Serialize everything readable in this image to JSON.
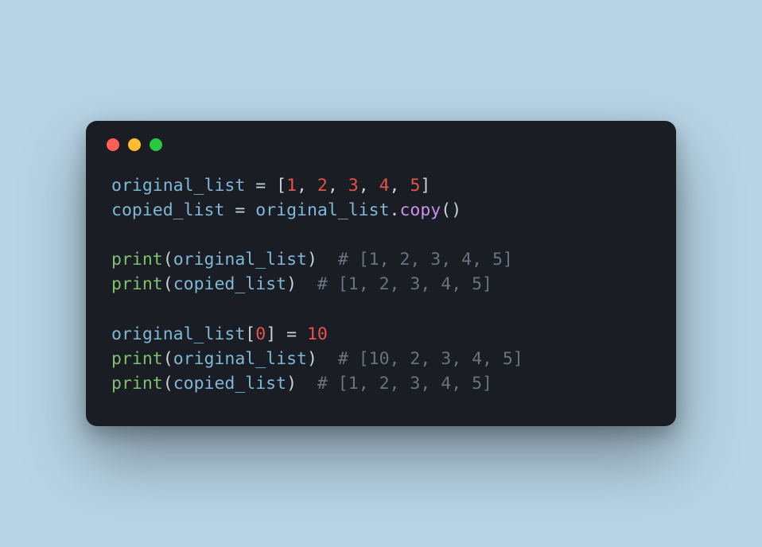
{
  "colors": {
    "bg_page": "#b7d4e5",
    "bg_window": "#1a1d24",
    "dot_red": "#ff5f56",
    "dot_yellow": "#ffbd2e",
    "dot_green": "#27c93f",
    "text_default": "#c9d1d9",
    "text_var": "#7fb8d6",
    "text_num": "#e5534b",
    "text_func": "#7ec16e",
    "text_method": "#c792ea",
    "text_comment": "#6b7280"
  },
  "code": {
    "lines": [
      [
        {
          "t": "original_list",
          "c": "var"
        },
        {
          "t": " = [",
          "c": "op"
        },
        {
          "t": "1",
          "c": "num"
        },
        {
          "t": ", ",
          "c": "op"
        },
        {
          "t": "2",
          "c": "num"
        },
        {
          "t": ", ",
          "c": "op"
        },
        {
          "t": "3",
          "c": "num"
        },
        {
          "t": ", ",
          "c": "op"
        },
        {
          "t": "4",
          "c": "num"
        },
        {
          "t": ", ",
          "c": "op"
        },
        {
          "t": "5",
          "c": "num"
        },
        {
          "t": "]",
          "c": "op"
        }
      ],
      [
        {
          "t": "copied_list",
          "c": "var"
        },
        {
          "t": " = ",
          "c": "op"
        },
        {
          "t": "original_list",
          "c": "var"
        },
        {
          "t": ".",
          "c": "op"
        },
        {
          "t": "copy",
          "c": "meth"
        },
        {
          "t": "()",
          "c": "op"
        }
      ],
      [],
      [
        {
          "t": "print",
          "c": "func"
        },
        {
          "t": "(",
          "c": "op"
        },
        {
          "t": "original_list",
          "c": "var"
        },
        {
          "t": ")  ",
          "c": "op"
        },
        {
          "t": "# [1, 2, 3, 4, 5]",
          "c": "cmt"
        }
      ],
      [
        {
          "t": "print",
          "c": "func"
        },
        {
          "t": "(",
          "c": "op"
        },
        {
          "t": "copied_list",
          "c": "var"
        },
        {
          "t": ")  ",
          "c": "op"
        },
        {
          "t": "# [1, 2, 3, 4, 5]",
          "c": "cmt"
        }
      ],
      [],
      [
        {
          "t": "original_list",
          "c": "var"
        },
        {
          "t": "[",
          "c": "op"
        },
        {
          "t": "0",
          "c": "num"
        },
        {
          "t": "] = ",
          "c": "op"
        },
        {
          "t": "10",
          "c": "num"
        }
      ],
      [
        {
          "t": "print",
          "c": "func"
        },
        {
          "t": "(",
          "c": "op"
        },
        {
          "t": "original_list",
          "c": "var"
        },
        {
          "t": ")  ",
          "c": "op"
        },
        {
          "t": "# [10, 2, 3, 4, 5]",
          "c": "cmt"
        }
      ],
      [
        {
          "t": "print",
          "c": "func"
        },
        {
          "t": "(",
          "c": "op"
        },
        {
          "t": "copied_list",
          "c": "var"
        },
        {
          "t": ")  ",
          "c": "op"
        },
        {
          "t": "# [1, 2, 3, 4, 5]",
          "c": "cmt"
        }
      ]
    ]
  }
}
